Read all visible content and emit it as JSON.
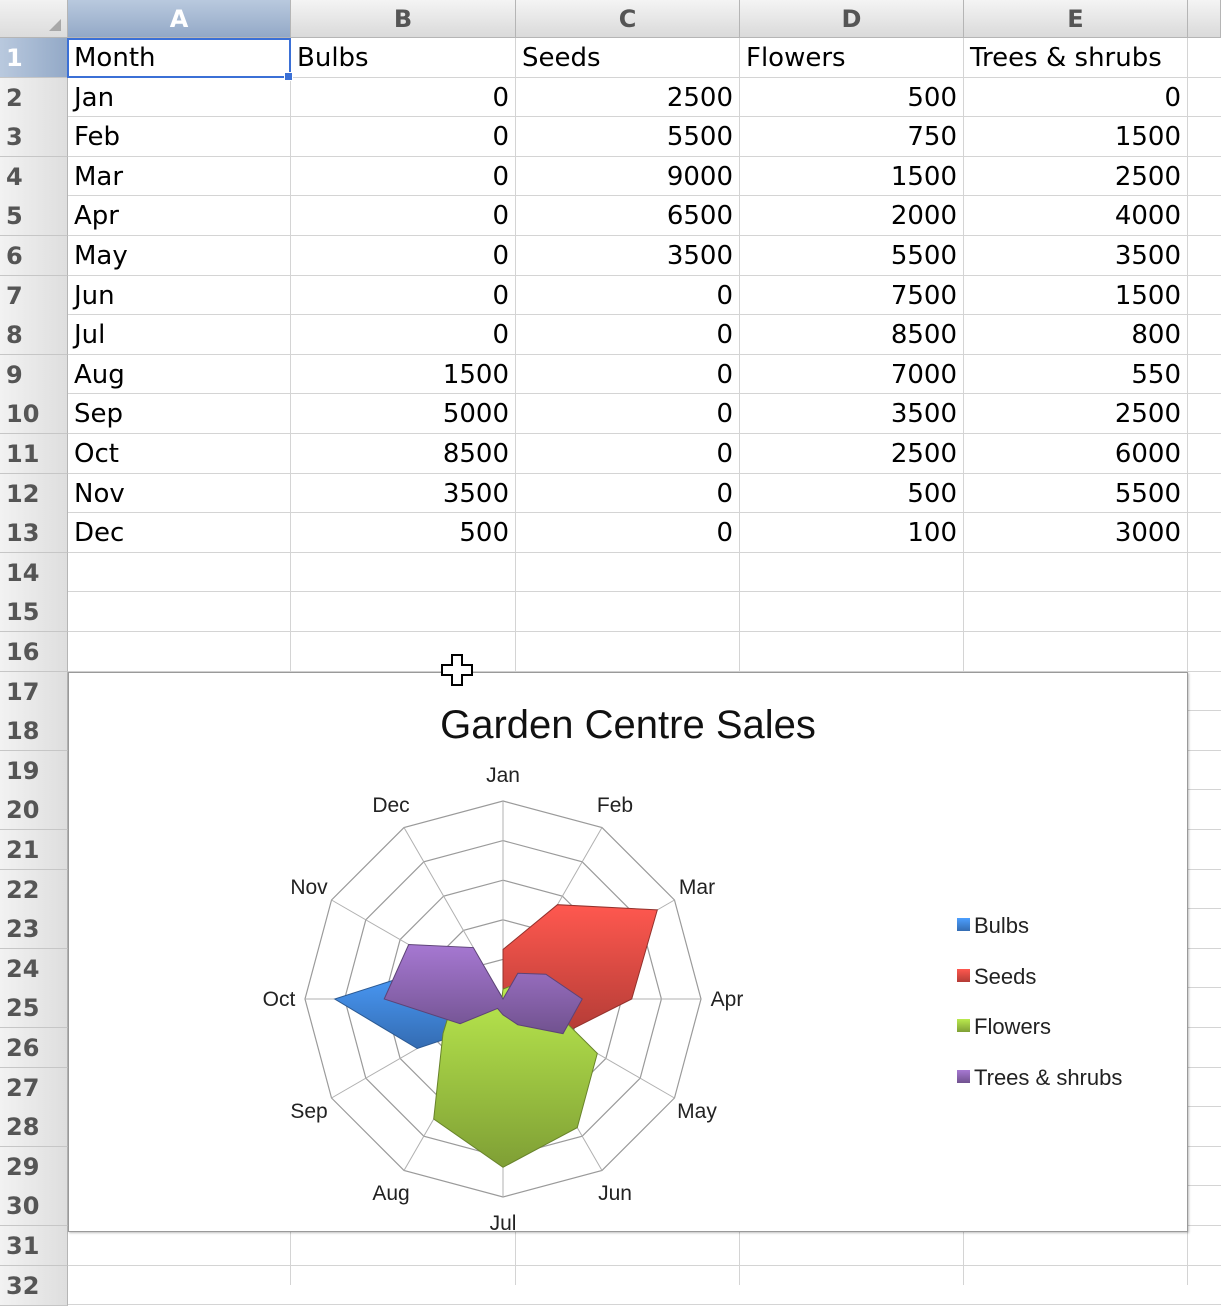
{
  "sheet": {
    "columns": [
      "A",
      "B",
      "C",
      "D",
      "E"
    ],
    "rows": [
      "1",
      "2",
      "3",
      "4",
      "5",
      "6",
      "7",
      "8",
      "9",
      "10",
      "11",
      "12",
      "13",
      "14",
      "15",
      "16",
      "17",
      "18",
      "19",
      "20",
      "21",
      "22",
      "23",
      "24",
      "25",
      "26",
      "27",
      "28",
      "29",
      "30",
      "31",
      "32"
    ],
    "header_row": [
      "Month",
      "Bulbs",
      "Seeds",
      "Flowers",
      "Trees & shrubs"
    ],
    "data_rows": [
      [
        "Jan",
        "0",
        "2500",
        "500",
        "0"
      ],
      [
        "Feb",
        "0",
        "5500",
        "750",
        "1500"
      ],
      [
        "Mar",
        "0",
        "9000",
        "1500",
        "2500"
      ],
      [
        "Apr",
        "0",
        "6500",
        "2000",
        "4000"
      ],
      [
        "May",
        "0",
        "3500",
        "5500",
        "3500"
      ],
      [
        "Jun",
        "0",
        "0",
        "7500",
        "1500"
      ],
      [
        "Jul",
        "0",
        "0",
        "8500",
        "800"
      ],
      [
        "Aug",
        "1500",
        "0",
        "7000",
        "550"
      ],
      [
        "Sep",
        "5000",
        "0",
        "3500",
        "2500"
      ],
      [
        "Oct",
        "8500",
        "0",
        "2500",
        "6000"
      ],
      [
        "Nov",
        "3500",
        "0",
        "500",
        "5500"
      ],
      [
        "Dec",
        "500",
        "0",
        "100",
        "3000"
      ]
    ],
    "selected_cell": "A1"
  },
  "chart_data": {
    "type": "radar",
    "style": "filled",
    "title": "Garden Centre Sales",
    "categories": [
      "Jan",
      "Feb",
      "Mar",
      "Apr",
      "May",
      "Jun",
      "Jul",
      "Aug",
      "Sep",
      "Oct",
      "Nov",
      "Dec"
    ],
    "series": [
      {
        "name": "Bulbs",
        "color": "#3d7fd1",
        "values": [
          0,
          0,
          0,
          0,
          0,
          0,
          0,
          1500,
          5000,
          8500,
          3500,
          500
        ]
      },
      {
        "name": "Seeds",
        "color": "#d2463f",
        "values": [
          2500,
          5500,
          9000,
          6500,
          3500,
          0,
          0,
          0,
          0,
          0,
          0,
          0
        ]
      },
      {
        "name": "Flowers",
        "color": "#95bb3e",
        "values": [
          500,
          750,
          1500,
          2000,
          5500,
          7500,
          8500,
          7000,
          3500,
          2500,
          500,
          100
        ]
      },
      {
        "name": "Trees & shrubs",
        "color": "#8560a8",
        "values": [
          0,
          1500,
          2500,
          4000,
          3500,
          1500,
          800,
          550,
          2500,
          6000,
          5500,
          3000
        ]
      }
    ],
    "range": [
      0,
      10000
    ],
    "gridlines": 5,
    "legend_position": "right"
  }
}
